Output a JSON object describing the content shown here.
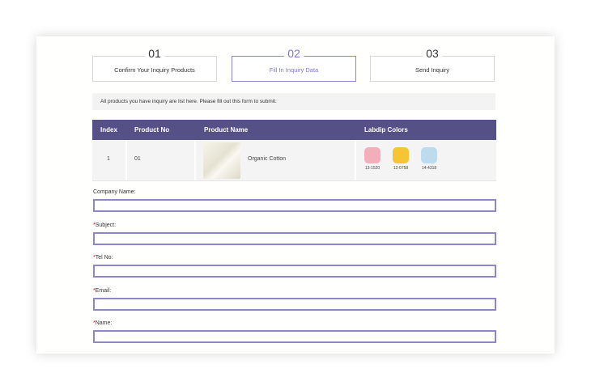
{
  "steps": [
    {
      "num": "01",
      "label": "Confirm Your Inquiry Products"
    },
    {
      "num": "02",
      "label": "Fill In Inquiry Data"
    },
    {
      "num": "03",
      "label": "Send Inquiry"
    }
  ],
  "notice": "All products you have inquiry are list here. Please fill out this form to submit.",
  "table": {
    "headers": {
      "index": "Index",
      "product_no": "Product No",
      "product_name": "Product Name",
      "labdip": "Labdip Colors"
    },
    "rows": [
      {
        "index": "1",
        "product_no": "01",
        "product_name": "Organic Cotton",
        "swatches": [
          {
            "code": "13-1520",
            "color": "#f2afbb"
          },
          {
            "code": "12-0758",
            "color": "#f5c534"
          },
          {
            "code": "14-4318",
            "color": "#bcdcee"
          }
        ]
      }
    ]
  },
  "form": {
    "company": {
      "label": "Company Name:",
      "value": ""
    },
    "subject": {
      "required_mark": "*",
      "label": "Subject:",
      "value": ""
    },
    "tel": {
      "required_mark": "*",
      "label": "Tel No:",
      "value": ""
    },
    "email": {
      "required_mark": "*",
      "label": "Email:",
      "value": ""
    },
    "name": {
      "required_mark": "*",
      "label": "Name:",
      "value": ""
    }
  },
  "colors": {
    "header_bg": "#555186",
    "accent": "#7a74d6",
    "input_border": "#8c88c8",
    "required": "#cc0000"
  }
}
